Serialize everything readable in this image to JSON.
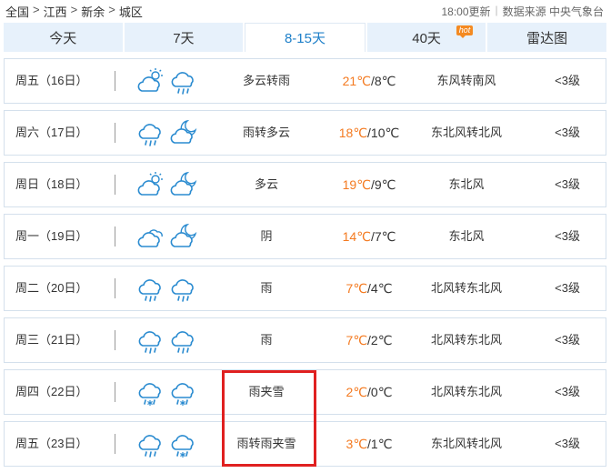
{
  "breadcrumb": {
    "items": [
      "全国",
      "江西",
      "新余",
      "城区"
    ],
    "separator": ">"
  },
  "meta": {
    "update_time": "18:00更新",
    "source_label": "数据来源 中央气象台"
  },
  "tabs": [
    {
      "label": "今天",
      "active": false
    },
    {
      "label": "7天",
      "active": false
    },
    {
      "label": "8-15天",
      "active": true
    },
    {
      "label": "40天",
      "active": false,
      "badge": "hot"
    },
    {
      "label": "雷达图",
      "active": false
    }
  ],
  "forecast": [
    {
      "day": "周五（16日）",
      "icons": [
        "partly-cloudy-day-icon",
        "rain-cloud-icon"
      ],
      "desc": "多云转雨",
      "high": "21℃",
      "low": "/8℃",
      "wind": "东风转南风",
      "level": "<3级"
    },
    {
      "day": "周六（17日）",
      "icons": [
        "rain-cloud-icon",
        "partly-cloudy-night-icon"
      ],
      "desc": "雨转多云",
      "high": "18℃",
      "low": "/10℃",
      "wind": "东北风转北风",
      "level": "<3级"
    },
    {
      "day": "周日（18日）",
      "icons": [
        "partly-cloudy-day-icon",
        "partly-cloudy-night-icon"
      ],
      "desc": "多云",
      "high": "19℃",
      "low": "/9℃",
      "wind": "东北风",
      "level": "<3级"
    },
    {
      "day": "周一（19日）",
      "icons": [
        "overcast-cloud-icon",
        "partly-cloudy-night-icon"
      ],
      "desc": "阴",
      "high": "14℃",
      "low": "/7℃",
      "wind": "东北风",
      "level": "<3级"
    },
    {
      "day": "周二（20日）",
      "icons": [
        "rain-cloud-icon",
        "rain-cloud-icon"
      ],
      "desc": "雨",
      "high": "7℃",
      "low": "/4℃",
      "wind": "北风转东北风",
      "level": "<3级"
    },
    {
      "day": "周三（21日）",
      "icons": [
        "rain-cloud-icon",
        "rain-cloud-icon"
      ],
      "desc": "雨",
      "high": "7℃",
      "low": "/2℃",
      "wind": "北风转东北风",
      "level": "<3级"
    },
    {
      "day": "周四（22日）",
      "icons": [
        "sleet-cloud-icon",
        "sleet-cloud-icon"
      ],
      "desc": "雨夹雪",
      "high": "2℃",
      "low": "/0℃",
      "wind": "北风转东北风",
      "level": "<3级"
    },
    {
      "day": "周五（23日）",
      "icons": [
        "rain-cloud-icon",
        "sleet-cloud-icon"
      ],
      "desc": "雨转雨夹雪",
      "high": "3℃",
      "low": "/1℃",
      "wind": "东北风转北风",
      "level": "<3级"
    }
  ],
  "colors": {
    "accent": "#1f80c9",
    "tab_bg": "#e7f1fb",
    "high_temp": "#f47a20",
    "icon_stroke": "#2a8bd0",
    "highlight": "#e02020"
  }
}
